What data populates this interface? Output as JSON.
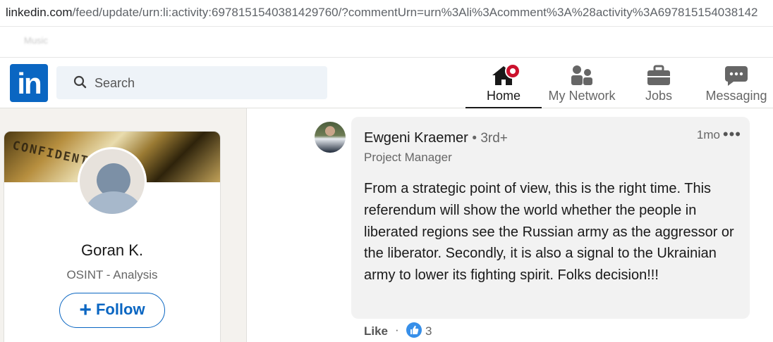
{
  "browser": {
    "url_host": "linkedin.com",
    "url_rest": "/feed/update/urn:li:activity:6978151540381429760/?commentUrn=urn%3Ali%3Acomment%3A%28activity%3A697815154038142"
  },
  "bookmarks": [
    "Music"
  ],
  "header": {
    "logo_text": "in",
    "search_placeholder": "Search",
    "nav": {
      "home": "Home",
      "network": "My Network",
      "jobs": "Jobs",
      "messaging": "Messaging"
    }
  },
  "profile": {
    "cover_text": "CONFIDENTIAL",
    "name": "Goran K.",
    "headline": "OSINT - Analysis",
    "follow_label": "Follow",
    "follow_icon": "plus-icon"
  },
  "comment": {
    "author": "Ewgeni Kraemer",
    "degree": "• 3rd+",
    "title": "Project Manager",
    "time": "1mo",
    "more": "•••",
    "text": "From a strategic point of view, this is the right time. This referendum will show the world whether the people in liberated regions see the Russian army as the aggressor or the liberator. Secondly, it is also a signal to the Ukrainian army to lower its fighting spirit. Folks decision!!!",
    "like_label": "Like",
    "separator": "·",
    "like_count": "3"
  },
  "colors": {
    "brand": "#0a66c2",
    "notification": "#cb112d",
    "reaction": "#378fe9"
  }
}
